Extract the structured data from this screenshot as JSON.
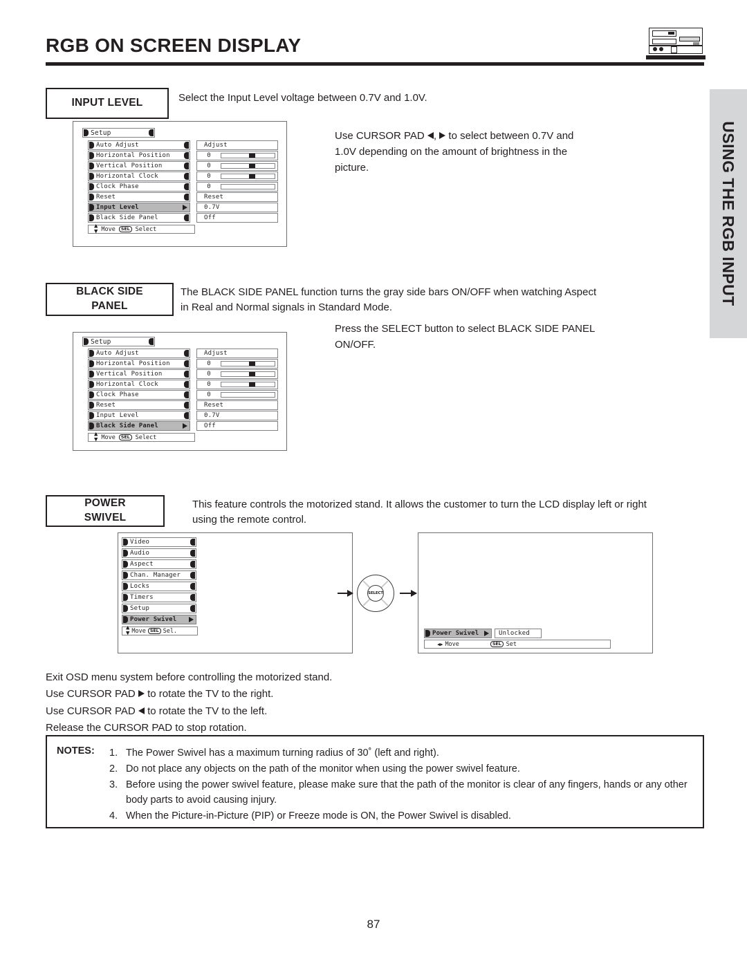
{
  "header": {
    "title": "RGB ON SCREEN DISPLAY",
    "device_icon": "av-receiver-icon"
  },
  "side_tab": {
    "label": "USING THE RGB INPUT",
    "bg_color": "#d4d6d8"
  },
  "sections": {
    "input_level": {
      "box_label": "INPUT LEVEL",
      "intro": "Select the Input Level voltage between 0.7V and 1.0V.",
      "instruction_lines": [
        "Use CURSOR PAD ◀, ▶ to select between 0.7V and",
        "1.0V depending on the amount of brightness in the",
        "picture."
      ]
    },
    "black_side_panel": {
      "box_label_line1": "BLACK SIDE",
      "box_label_line2": "PANEL",
      "description_lines": [
        "The BLACK SIDE PANEL function turns the gray side bars ON/OFF when watching Aspect",
        "in Real and Normal signals in Standard Mode."
      ],
      "instruction_lines": [
        "Press the SELECT button to select BLACK SIDE PANEL",
        "ON/OFF."
      ]
    },
    "power_swivel": {
      "box_label_line1": "POWER",
      "box_label_line2": "SWIVEL",
      "description_lines": [
        "This feature controls the motorized stand.  It allows the customer to turn the LCD display left or right",
        "using the remote control."
      ],
      "usage_lines": [
        "Exit OSD menu system before controlling the motorized stand.",
        "Use CURSOR PAD ▶ to rotate the TV to the right.",
        "Use CURSOR PAD ◀ to rotate the TV to the left.",
        "Release the CURSOR PAD to stop rotation."
      ]
    }
  },
  "osd_setup_menu_1": {
    "title": "Setup",
    "highlighted_item": "Input Level",
    "rows": [
      {
        "label": "Auto Adjust",
        "value": "Adjust",
        "kind": "text"
      },
      {
        "label": "Horizontal Position",
        "value": "0",
        "kind": "slider",
        "knob_pct": 54
      },
      {
        "label": "Vertical Position",
        "value": "0",
        "kind": "slider",
        "knob_pct": 54
      },
      {
        "label": "Horizontal Clock",
        "value": "0",
        "kind": "slider",
        "knob_pct": 54
      },
      {
        "label": "Clock Phase",
        "value": "0",
        "kind": "slider",
        "knob_pct": -1
      },
      {
        "label": "Reset",
        "value": "Reset",
        "kind": "text"
      },
      {
        "label": "Input Level",
        "value": "0.7V",
        "kind": "text"
      },
      {
        "label": "Black Side Panel",
        "value": "Off",
        "kind": "text"
      }
    ],
    "hint_move": "Move",
    "hint_sel_pill": "SEL",
    "hint_select": "Select"
  },
  "osd_setup_menu_2": {
    "title": "Setup",
    "highlighted_item": "Black Side Panel",
    "rows": [
      {
        "label": "Auto Adjust",
        "value": "Adjust",
        "kind": "text"
      },
      {
        "label": "Horizontal Position",
        "value": "0",
        "kind": "slider",
        "knob_pct": 54
      },
      {
        "label": "Vertical Position",
        "value": "0",
        "kind": "slider",
        "knob_pct": 54
      },
      {
        "label": "Horizontal Clock",
        "value": "0",
        "kind": "slider",
        "knob_pct": 54
      },
      {
        "label": "Clock Phase",
        "value": "0",
        "kind": "slider",
        "knob_pct": -1
      },
      {
        "label": "Reset",
        "value": "Reset",
        "kind": "text"
      },
      {
        "label": "Input Level",
        "value": "0.7V",
        "kind": "text"
      },
      {
        "label": "Black Side Panel",
        "value": "Off",
        "kind": "text"
      }
    ],
    "hint_move": "Move",
    "hint_sel_pill": "SEL",
    "hint_select": "Select"
  },
  "osd_main_menu": {
    "items": [
      "Video",
      "Audio",
      "Aspect",
      "Chan. Manager",
      "Locks",
      "Timers",
      "Setup",
      "Power Swivel"
    ],
    "highlighted_item": "Power Swivel",
    "hint_move": "Move",
    "hint_sel_pill": "SEL",
    "hint_select": "Sel."
  },
  "osd_power_swivel_panel": {
    "label": "Power Swivel",
    "value": "Unlocked",
    "hint_move": "Move",
    "hint_sel_pill": "SEL",
    "hint_set": "Set"
  },
  "cursor_pad_icon": {
    "center_label": "SELECT"
  },
  "notes": {
    "label": "NOTES:",
    "items": [
      {
        "num": "1.",
        "text": "The Power Swivel has a maximum turning radius of 30˚ (left and right)."
      },
      {
        "num": "2.",
        "text": "Do not place any objects on the path of the monitor when using the power swivel feature."
      },
      {
        "num": "3.",
        "text": "Before using the power swivel feature, please make sure that the path of the monitor is clear of any fingers, hands or any other body parts to avoid causing injury."
      },
      {
        "num": "4.",
        "text": "When the Picture-in-Picture (PIP) or Freeze mode is ON, the Power Swivel is disabled."
      }
    ]
  },
  "footer": {
    "page_number": "87"
  }
}
